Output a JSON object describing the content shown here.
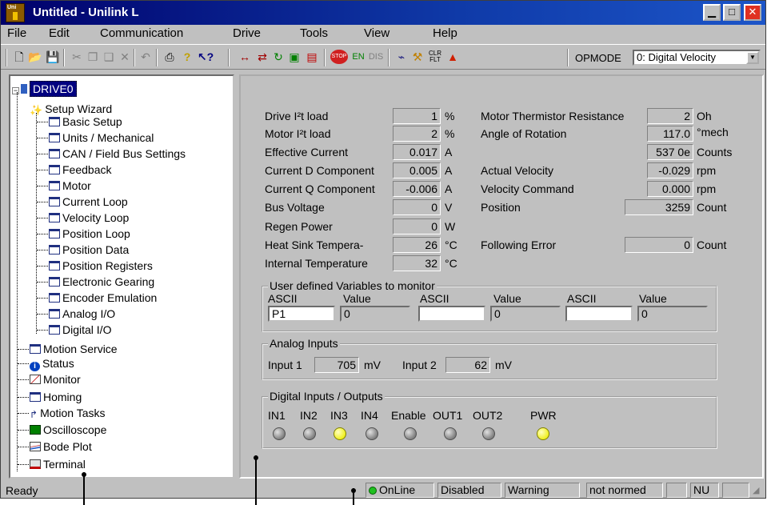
{
  "window": {
    "title": "Untitled - Unilink L",
    "app_icon_text": "Uni"
  },
  "menu": [
    "File",
    "Edit",
    "Communication",
    "Drive",
    "Tools",
    "View",
    "Help"
  ],
  "toolbar": {
    "opmode_label": "OPMODE",
    "opmode_value": "0: Digital Velocity",
    "en": "EN",
    "dis": "DIS",
    "clr": "CLR",
    "flt": "FLT",
    "stop": "STOP",
    "help_q": "?",
    "help_arrow": "↖?"
  },
  "tree": {
    "root": "DRIVE0",
    "wizard": "Setup Wizard",
    "wizard_items": [
      "Basic Setup",
      "Units / Mechanical",
      "CAN / Field Bus Settings",
      "Feedback",
      "Motor",
      "Current Loop",
      "Velocity Loop",
      "Position Loop",
      "Position Data",
      "Position Registers",
      "Electronic Gearing",
      "Encoder Emulation",
      "Analog I/O",
      "Digital I/O"
    ],
    "items": [
      "Motion Service",
      "Status",
      "Monitor",
      "Homing",
      "Motion Tasks",
      "Oscilloscope",
      "Bode Plot",
      "Terminal"
    ]
  },
  "monitor": {
    "left": [
      {
        "label": "Drive I²t load",
        "value": "1",
        "unit": "%"
      },
      {
        "label": "Motor I²t load",
        "value": "2",
        "unit": "%"
      },
      {
        "label": "Effective Current",
        "value": "0.017",
        "unit": "A"
      },
      {
        "label": "Current D Component",
        "value": "0.005",
        "unit": "A"
      },
      {
        "label": "Current Q Component",
        "value": "-0.006",
        "unit": "A"
      },
      {
        "label": "Bus Voltage",
        "value": "0",
        "unit": "V"
      },
      {
        "label": "Regen Power",
        "value": "0",
        "unit": "W"
      },
      {
        "label": "Heat Sink Tempera-",
        "value": "26",
        "unit": "°C"
      },
      {
        "label": "Internal Temperature",
        "value": "32",
        "unit": "°C"
      }
    ],
    "right": {
      "thermistor": {
        "label": "Motor Thermistor Resistance",
        "value": "2",
        "unit": "Oh"
      },
      "rotation": {
        "label": "Angle of Rotation",
        "value": "117.0",
        "unit": "°mech"
      },
      "counts": {
        "value": "537 0e",
        "unit": "Counts"
      },
      "actual_velocity": {
        "label": "Actual Velocity",
        "value": "-0.029",
        "unit": "rpm"
      },
      "velocity_command": {
        "label": "Velocity Command",
        "value": "0.000",
        "unit": "rpm"
      },
      "position": {
        "label": "Position",
        "value": "3259",
        "unit": "Count"
      },
      "following_error": {
        "label": "Following Error",
        "value": "0",
        "unit": "Count"
      }
    },
    "user_vars": {
      "title": "User defined Variables to monitor",
      "ascii_label": "ASCII",
      "value_label": "Value",
      "slots": [
        {
          "ascii": "P1",
          "value": "0"
        },
        {
          "ascii": "",
          "value": "0"
        },
        {
          "ascii": "",
          "value": "0"
        }
      ]
    },
    "analog": {
      "title": "Analog Inputs",
      "inputs": [
        {
          "label": "Input 1",
          "value": "705",
          "unit": "mV"
        },
        {
          "label": "Input 2",
          "value": "62",
          "unit": "mV"
        }
      ]
    },
    "digital": {
      "title": "Digital Inputs / Outputs",
      "channels": [
        {
          "name": "IN1",
          "on": false
        },
        {
          "name": "IN2",
          "on": false
        },
        {
          "name": "IN3",
          "on": true
        },
        {
          "name": "IN4",
          "on": false
        },
        {
          "name": "Enable",
          "on": false
        },
        {
          "name": "OUT1",
          "on": false
        },
        {
          "name": "OUT2",
          "on": false
        },
        {
          "name": "PWR",
          "on": true
        }
      ]
    }
  },
  "status": {
    "text": "Ready",
    "online": "OnLine",
    "state": "Disabled",
    "warning": "Warning",
    "norm": "not normed",
    "unit": "NU"
  },
  "colors": {
    "title_gradient_start": "#00006b",
    "selection": "#000080",
    "led_on": "#f0f020",
    "led_online": "#20c020",
    "close_button": "#e03020"
  }
}
